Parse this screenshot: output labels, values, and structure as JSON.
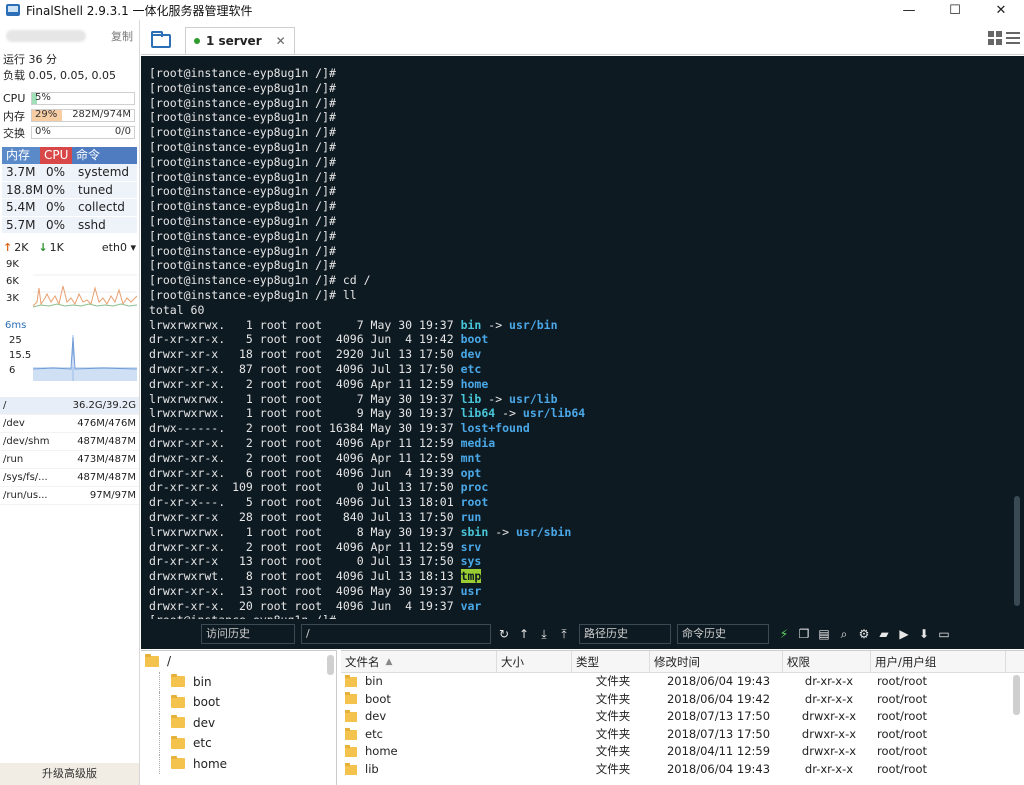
{
  "window": {
    "title": "FinalShell 2.9.3.1 一体化服务器管理软件",
    "minimize": "—",
    "maximize": "☐",
    "close": "✕"
  },
  "sidebar": {
    "copy_label": "复制",
    "uptime": "运行 36 分",
    "load": "负载 0.05, 0.05, 0.05",
    "cpu": {
      "label": "CPU",
      "pct": "5%",
      "fraction": 0.05,
      "color": "#9fe0b8"
    },
    "mem": {
      "label": "内存",
      "pct": "29%",
      "value": "282M/974M",
      "fraction": 0.29,
      "color": "#f7cda4"
    },
    "swap": {
      "label": "交换",
      "pct": "0%",
      "value": "0/0",
      "fraction": 0.0,
      "color": "#cfe3f6"
    },
    "proc_headers": [
      "内存",
      "CPU",
      "命令"
    ],
    "processes": [
      {
        "mem": "3.7M",
        "cpu": "0%",
        "cmd": "systemd"
      },
      {
        "mem": "18.8M",
        "cpu": "0%",
        "cmd": "tuned"
      },
      {
        "mem": "5.4M",
        "cpu": "0%",
        "cmd": "collectd"
      },
      {
        "mem": "5.7M",
        "cpu": "0%",
        "cmd": "sshd"
      }
    ],
    "net": {
      "up": "2K",
      "down": "1K",
      "iface": "eth0",
      "ticks": [
        "9K",
        "6K",
        "3K"
      ]
    },
    "latency": {
      "label": "6ms",
      "ticks": [
        "25",
        "15.5",
        "6"
      ]
    },
    "disks": [
      {
        "name": "/",
        "value": "36.2G/39.2G"
      },
      {
        "name": "/dev",
        "value": "476M/476M"
      },
      {
        "name": "/dev/shm",
        "value": "487M/487M"
      },
      {
        "name": "/run",
        "value": "473M/487M"
      },
      {
        "name": "/sys/fs/...",
        "value": "487M/487M"
      },
      {
        "name": "/run/us...",
        "value": "97M/97M"
      }
    ],
    "upgrade": "升级高级版"
  },
  "tabs": [
    {
      "label": "1 server",
      "close": "✕"
    }
  ],
  "terminal": {
    "prompt": "[root@instance-eyp8ug1n /]#",
    "empty_prompts": 14,
    "cmd1": "[root@instance-eyp8ug1n /]# cd /",
    "cmd2": "[root@instance-eyp8ug1n /]# ll",
    "total": "total 60",
    "entries": [
      {
        "prefix": "lrwxrwxrwx.   1 root root     7 May 30 19:37 ",
        "name": "bin",
        "target": "usr/bin",
        "kind": "link"
      },
      {
        "prefix": "dr-xr-xr-x.   5 root root  4096 Jun  4 19:42 ",
        "name": "boot",
        "kind": "dir"
      },
      {
        "prefix": "drwxr-xr-x   18 root root  2920 Jul 13 17:50 ",
        "name": "dev",
        "kind": "dir"
      },
      {
        "prefix": "drwxr-xr-x.  87 root root  4096 Jul 13 17:50 ",
        "name": "etc",
        "kind": "dir"
      },
      {
        "prefix": "drwxr-xr-x.   2 root root  4096 Apr 11 12:59 ",
        "name": "home",
        "kind": "dir"
      },
      {
        "prefix": "lrwxrwxrwx.   1 root root     7 May 30 19:37 ",
        "name": "lib",
        "target": "usr/lib",
        "kind": "link"
      },
      {
        "prefix": "lrwxrwxrwx.   1 root root     9 May 30 19:37 ",
        "name": "lib64",
        "target": "usr/lib64",
        "kind": "link"
      },
      {
        "prefix": "drwx------.   2 root root 16384 May 30 19:37 ",
        "name": "lost+found",
        "kind": "dir"
      },
      {
        "prefix": "drwxr-xr-x.   2 root root  4096 Apr 11 12:59 ",
        "name": "media",
        "kind": "dir"
      },
      {
        "prefix": "drwxr-xr-x.   2 root root  4096 Apr 11 12:59 ",
        "name": "mnt",
        "kind": "dir"
      },
      {
        "prefix": "drwxr-xr-x.   6 root root  4096 Jun  4 19:39 ",
        "name": "opt",
        "kind": "dir"
      },
      {
        "prefix": "dr-xr-xr-x  109 root root     0 Jul 13 17:50 ",
        "name": "proc",
        "kind": "dir"
      },
      {
        "prefix": "dr-xr-x---.   5 root root  4096 Jul 13 18:01 ",
        "name": "root",
        "kind": "dir"
      },
      {
        "prefix": "drwxr-xr-x   28 root root   840 Jul 13 17:50 ",
        "name": "run",
        "kind": "dir"
      },
      {
        "prefix": "lrwxrwxrwx.   1 root root     8 May 30 19:37 ",
        "name": "sbin",
        "target": "usr/sbin",
        "kind": "link"
      },
      {
        "prefix": "drwxr-xr-x.   2 root root  4096 Apr 11 12:59 ",
        "name": "srv",
        "kind": "dir"
      },
      {
        "prefix": "dr-xr-xr-x   13 root root     0 Jul 13 17:50 ",
        "name": "sys",
        "kind": "dir"
      },
      {
        "prefix": "drwxrwxrwt.   8 root root  4096 Jul 13 18:13 ",
        "name": "tmp",
        "kind": "tmp"
      },
      {
        "prefix": "drwxr-xr-x.  13 root root  4096 May 30 19:37 ",
        "name": "usr",
        "kind": "dir"
      },
      {
        "prefix": "drwxr-xr-x.  20 root root  4096 Jun  4 19:37 ",
        "name": "var",
        "kind": "dir"
      }
    ],
    "last_prompt": "[root@instance-eyp8ug1n /]#"
  },
  "cmdbar": {
    "history_access": "访问历史",
    "path": "/",
    "path_history": "路径历史",
    "cmd_history": "命令历史"
  },
  "tree": {
    "root": "/",
    "items": [
      "bin",
      "boot",
      "dev",
      "etc",
      "home"
    ]
  },
  "filelist": {
    "headers": [
      "文件名",
      "大小",
      "类型",
      "修改时间",
      "权限",
      "用户/用户组"
    ],
    "rows": [
      {
        "name": "bin",
        "size": "",
        "type": "文件夹",
        "time": "2018/06/04 19:43",
        "perm": "dr-xr-x-x",
        "user": "root/root"
      },
      {
        "name": "boot",
        "size": "",
        "type": "文件夹",
        "time": "2018/06/04 19:42",
        "perm": "dr-xr-x-x",
        "user": "root/root"
      },
      {
        "name": "dev",
        "size": "",
        "type": "文件夹",
        "time": "2018/07/13 17:50",
        "perm": "drwxr-x-x",
        "user": "root/root"
      },
      {
        "name": "etc",
        "size": "",
        "type": "文件夹",
        "time": "2018/07/13 17:50",
        "perm": "drwxr-x-x",
        "user": "root/root"
      },
      {
        "name": "home",
        "size": "",
        "type": "文件夹",
        "time": "2018/04/11 12:59",
        "perm": "drwxr-x-x",
        "user": "root/root"
      },
      {
        "name": "lib",
        "size": "",
        "type": "文件夹",
        "time": "2018/06/04 19:43",
        "perm": "dr-xr-x-x",
        "user": "root/root"
      }
    ]
  },
  "colors": {
    "terminal_bg": "#0e1a22",
    "dir": "#4aa8e8",
    "link": "#48c6d9",
    "tmp_bg": "#9acd32"
  }
}
